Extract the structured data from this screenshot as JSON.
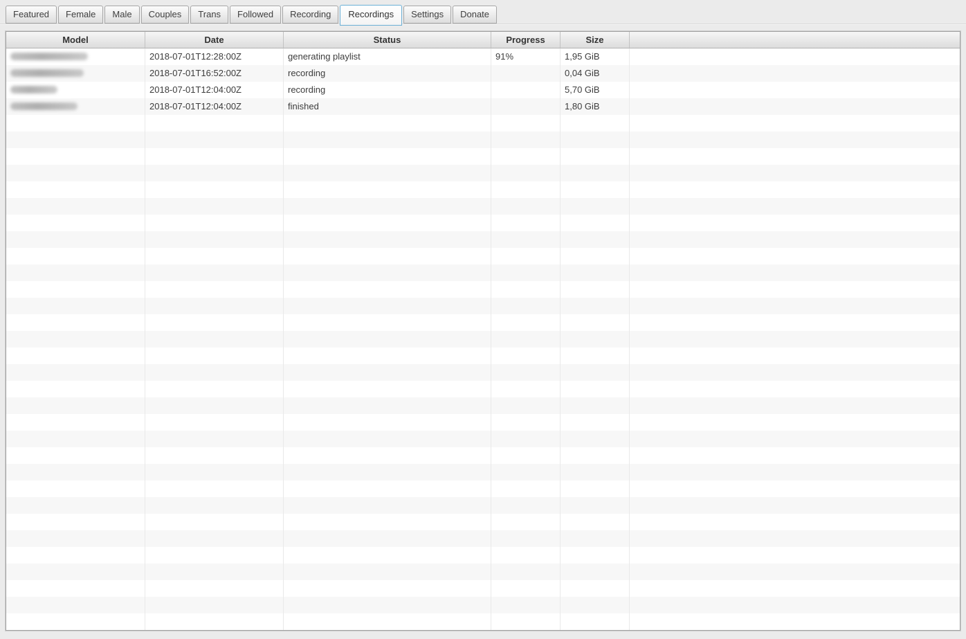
{
  "colors": {
    "active_tab_border": "#6aafd6",
    "window_background": "#ebebeb",
    "row_alt_background": "#f7f7f7"
  },
  "tabs": {
    "items": [
      {
        "label": "Featured",
        "active": false
      },
      {
        "label": "Female",
        "active": false
      },
      {
        "label": "Male",
        "active": false
      },
      {
        "label": "Couples",
        "active": false
      },
      {
        "label": "Trans",
        "active": false
      },
      {
        "label": "Followed",
        "active": false
      },
      {
        "label": "Recording",
        "active": false
      },
      {
        "label": "Recordings",
        "active": true
      },
      {
        "label": "Settings",
        "active": false
      },
      {
        "label": "Donate",
        "active": false
      }
    ]
  },
  "table": {
    "columns": [
      {
        "label": "Model"
      },
      {
        "label": "Date"
      },
      {
        "label": "Status"
      },
      {
        "label": "Progress"
      },
      {
        "label": "Size"
      },
      {
        "label": ""
      }
    ],
    "rows": [
      {
        "model": "",
        "model_redacted": true,
        "blur_width": 112,
        "date": "2018-07-01T12:28:00Z",
        "status": "generating playlist",
        "progress": "91%",
        "size": "1,95 GiB"
      },
      {
        "model": "",
        "model_redacted": true,
        "blur_width": 106,
        "date": "2018-07-01T16:52:00Z",
        "status": "recording",
        "progress": "",
        "size": "0,04 GiB"
      },
      {
        "model": "",
        "model_redacted": true,
        "blur_width": 68,
        "date": "2018-07-01T12:04:00Z",
        "status": "recording",
        "progress": "",
        "size": "5,70 GiB"
      },
      {
        "model": "",
        "model_redacted": true,
        "blur_width": 97,
        "date": "2018-07-01T12:04:00Z",
        "status": "finished",
        "progress": "",
        "size": "1,80 GiB"
      }
    ],
    "empty_row_count": 31
  }
}
